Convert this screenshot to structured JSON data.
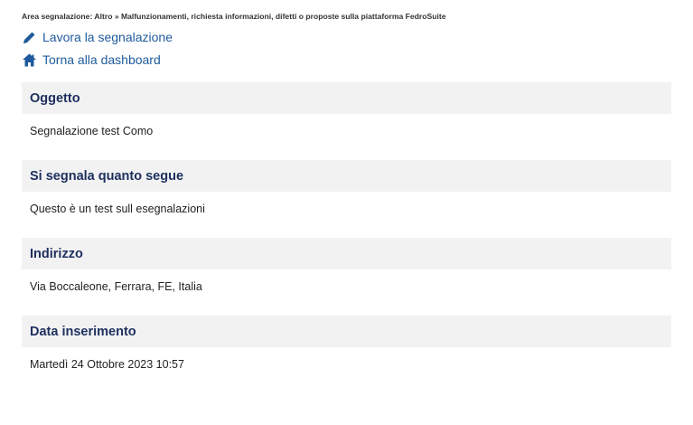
{
  "breadcrumb": {
    "text": "Area segnalazione: Altro » Malfunzionamenti, richiesta informazioni, difetti o proposte sulla piattaforma FedroSuite"
  },
  "actions": [
    {
      "label": "Lavora la segnalazione",
      "icon": "pencil-icon"
    },
    {
      "label": "Torna alla dashboard",
      "icon": "home-icon"
    }
  ],
  "sections": [
    {
      "title": "Oggetto",
      "value": "Segnalazione test Como"
    },
    {
      "title": "Si segnala quanto segue",
      "value": "Questo è un test sull esegnalazioni"
    },
    {
      "title": "Indirizzo",
      "value": "Via Boccaleone, Ferrara, FE, Italia"
    },
    {
      "title": "Data inserimento",
      "value": "Martedì 24 Ottobre 2023 10:57"
    }
  ],
  "colors": {
    "link": "#1f5b9c",
    "section_title": "#1d2f5e",
    "section_bg": "#f2f2f2"
  }
}
